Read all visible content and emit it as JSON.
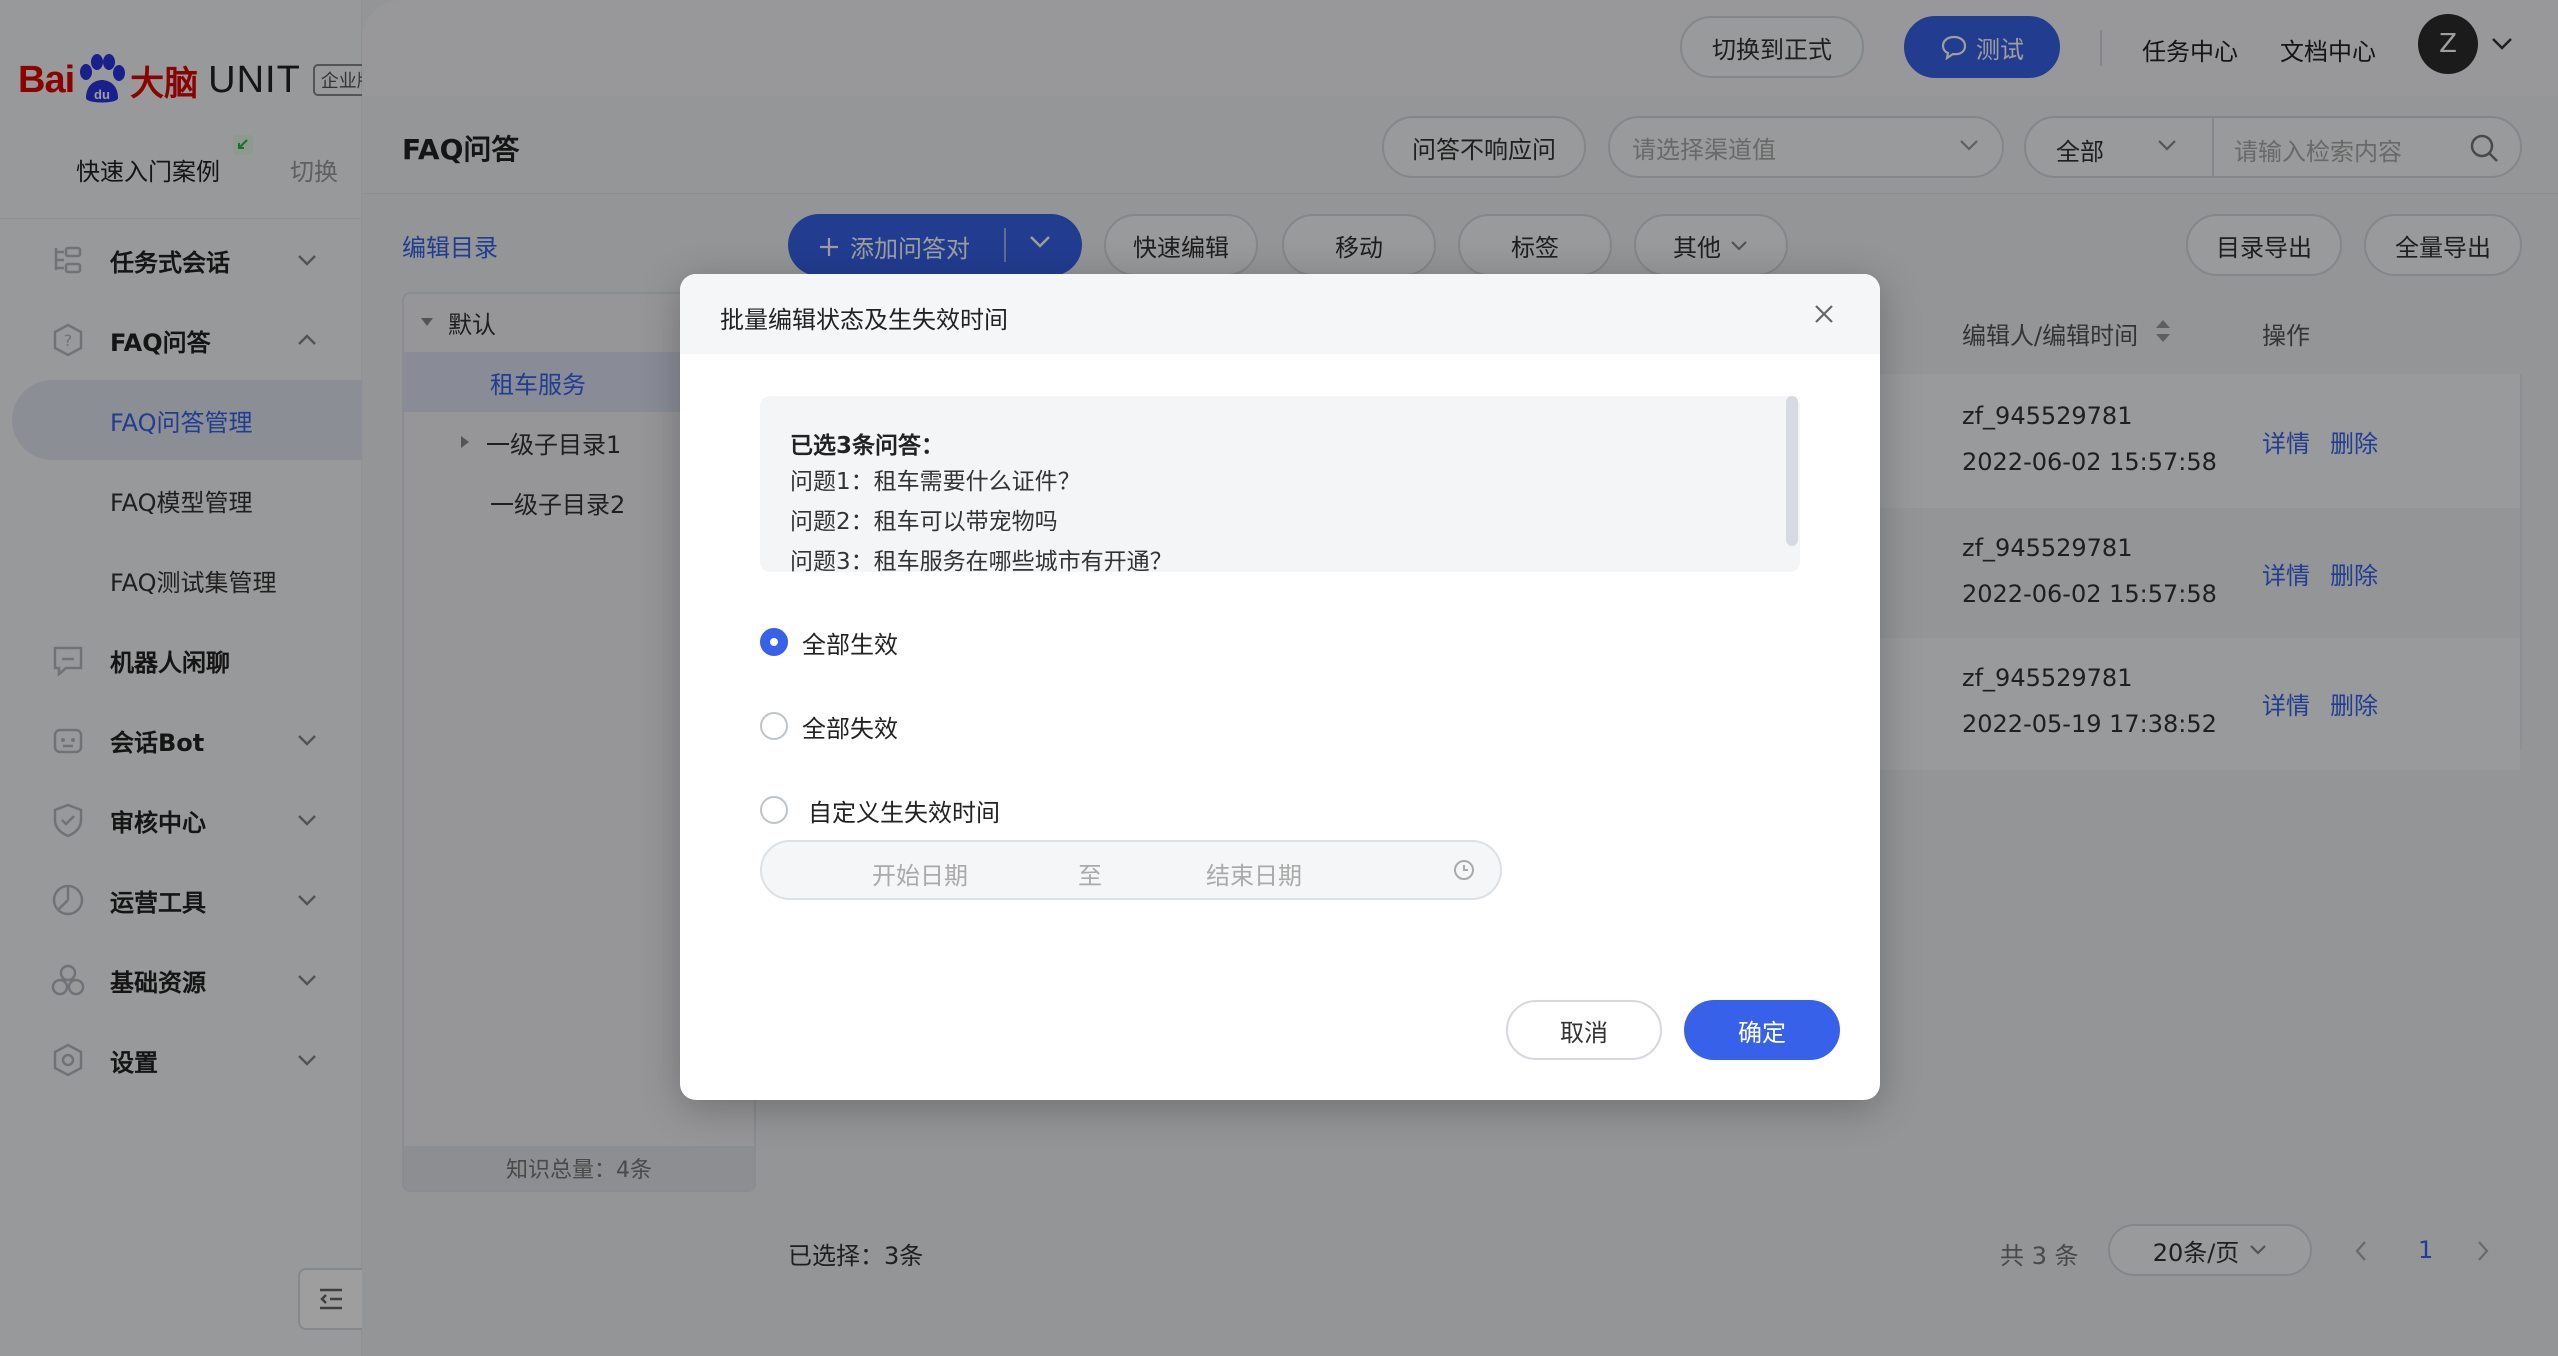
{
  "brand": {
    "bai": "Bai",
    "du": "du",
    "dn": "大脑",
    "unit": "UNIT",
    "edition": "企业版"
  },
  "sidebar": {
    "quick_start": "快速入门案例",
    "switch": "切换",
    "items": [
      {
        "label": "任务式会话",
        "icon": "task-dialog-icon"
      },
      {
        "label": "FAQ问答",
        "icon": "faq-icon"
      },
      {
        "label": "机器人闲聊",
        "icon": "chat-icon"
      },
      {
        "label": "会话Bot",
        "icon": "bot-icon"
      },
      {
        "label": "审核中心",
        "icon": "shield-icon"
      },
      {
        "label": "运营工具",
        "icon": "operation-tool-icon"
      },
      {
        "label": "基础资源",
        "icon": "resource-icon"
      },
      {
        "label": "设置",
        "icon": "settings-icon"
      }
    ],
    "faq_sub": [
      "FAQ问答管理",
      "FAQ模型管理",
      "FAQ测试集管理"
    ]
  },
  "topbar": {
    "switch_formal": "切换到正式",
    "test": "测试",
    "task_center": "任务中心",
    "doc_center": "文档中心",
    "avatar_initial": "Z"
  },
  "page": {
    "title": "FAQ问答",
    "no_reply": "问答不响应问",
    "channel_placeholder": "请选择渠道值",
    "scope": "全部",
    "search_placeholder": "请输入检索内容"
  },
  "directory": {
    "title": "编辑目录",
    "tree": [
      "默认",
      "租车服务",
      "一级子目录1",
      "一级子目录2"
    ],
    "footer": "知识总量：4条"
  },
  "toolbar": {
    "add": "添加问答对",
    "quick_edit": "快速编辑",
    "move": "移动",
    "tag": "标签",
    "other": "其他",
    "export_dir": "目录导出",
    "export_all": "全量导出"
  },
  "table": {
    "headers": {
      "editor": "编辑人/编辑时间",
      "ops": "操作"
    },
    "rows": [
      {
        "editor": "zf_945529781",
        "time": "2022-06-02 15:57:58",
        "detail": "详情",
        "delete": "删除"
      },
      {
        "editor": "zf_945529781",
        "time": "2022-06-02 15:57:58",
        "detail": "详情",
        "delete": "删除"
      },
      {
        "editor": "zf_945529781",
        "time": "2022-05-19 17:38:52",
        "detail": "详情",
        "delete": "删除"
      }
    ]
  },
  "footer": {
    "selected": "已选择：3条",
    "total": "共 3 条",
    "page_size": "20条/页",
    "page": "1"
  },
  "modal": {
    "title": "批量编辑状态及生失效时间",
    "selected_head": "已选3条问答：",
    "questions": [
      "问题1：租车需要什么证件？",
      "问题2：租车可以带宠物吗",
      "问题3：租车服务在哪些城市有开通？"
    ],
    "options": [
      "全部生效",
      "全部失效",
      "自定义生失效时间"
    ],
    "start_placeholder": "开始日期",
    "to": "至",
    "end_placeholder": "结束日期",
    "cancel": "取消",
    "ok": "确定"
  },
  "colors": {
    "primary": "#3761e8",
    "brand_red": "#e10602"
  }
}
